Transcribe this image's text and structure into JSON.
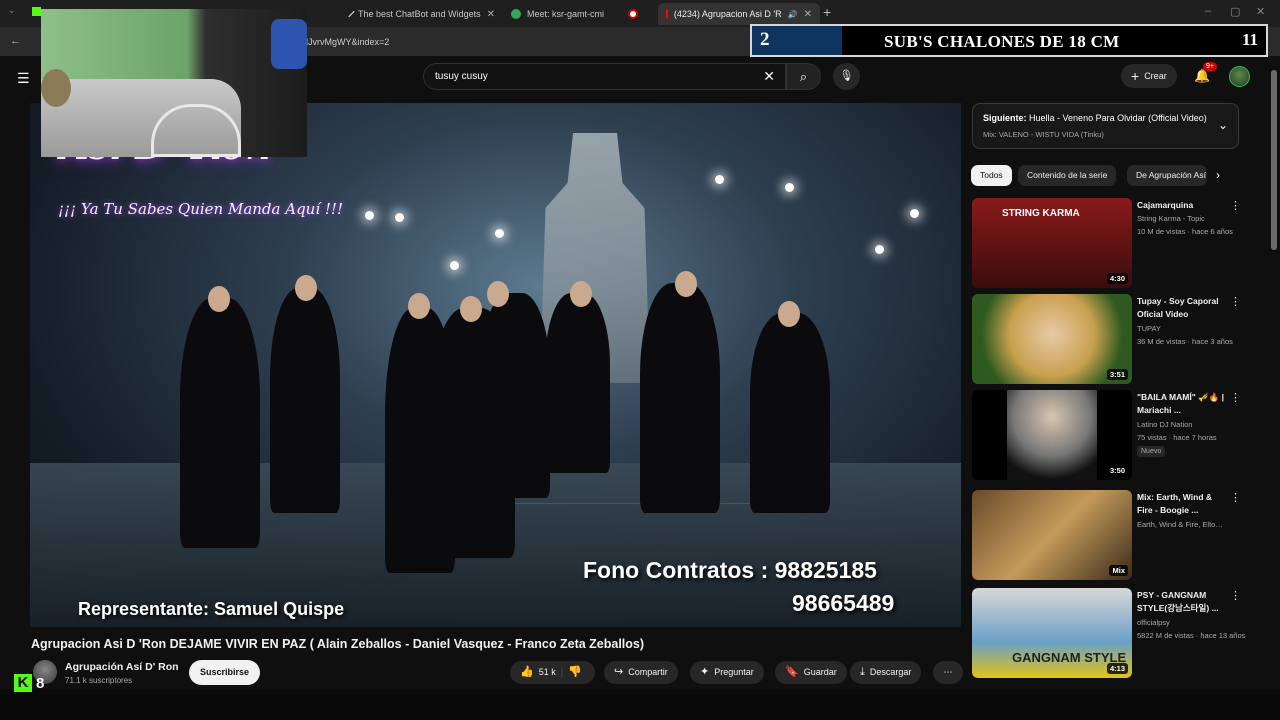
{
  "browser": {
    "tabs": [
      {
        "label": "ts"
      },
      {
        "label": "The best ChatBot and Widgets"
      },
      {
        "label": "Meet: ksr-gamt-cmi"
      },
      {
        "label": ""
      },
      {
        "label": "(4234) Agrupacion Asi D 'R"
      }
    ],
    "url": "lJvrvMgWY&index=2"
  },
  "overlay": {
    "sub_count": "2",
    "sub_goal": "SUB'S CHALONES DE 18 CM",
    "sub_target": "11",
    "kick_count": "8"
  },
  "masthead": {
    "search_value": "tusuy cusuy",
    "create_label": "Crear",
    "notif_badge": "9+"
  },
  "video": {
    "overlay_logo": "Asi D' Ron",
    "overlay_tagline": "¡¡¡ Ya Tu Sabes Quien Manda Aquí !!!",
    "overlay_contract": "Fono Contratos :   98825185",
    "overlay_contract2": "98665489",
    "overlay_rep": "Representante: Samuel Quispe",
    "title": "Agrupacion Asi D 'Ron DEJAME VIVIR EN PAZ ( Alain Zeballos - Daniel Vasquez - Franco Zeta Zeballos)",
    "channel": "Agrupación Así D' Ron",
    "subscribers": "71.1 k suscriptores",
    "subscribe_label": "Suscribirse",
    "likes": "51 k",
    "share_label": "Compartir",
    "ask_label": "Preguntar",
    "save_label": "Guardar",
    "download_label": "Descargar"
  },
  "sidebar": {
    "upnext_prefix": "Siguiente:",
    "upnext_title": "Huella - Veneno Para Olvidar (Official Video)",
    "upnext_sub": "Mix: VALENO - WISTU VIDA (Tinku)",
    "chips": [
      "Todos",
      "Contenido de la serie",
      "De Agrupación Así"
    ],
    "recs": [
      {
        "title": "Cajamarquina",
        "channel": "String Karma - Topic",
        "views": "10 M de vistas · hace 6 años",
        "duration": "4:30",
        "thumb_text": "STRING KARMA",
        "nuevo": ""
      },
      {
        "title": "Tupay - Soy Caporal Oficial Video",
        "channel": "TUPAY",
        "views": "36 M de vistas · hace 3 años",
        "duration": "3:51",
        "thumb_text": "",
        "nuevo": ""
      },
      {
        "title": "\"BAILA MAMÍ\" 🎺🔥 | Mariachi ...",
        "channel": "Latino DJ Nation",
        "views": "75 vistas · hace 7 horas",
        "duration": "3:50",
        "thumb_text": "",
        "nuevo": "Nuevo"
      },
      {
        "title": "Mix: Earth, Wind & Fire - Boogie ...",
        "channel": "Earth, Wind & Fire, Elton John...",
        "views": "",
        "duration": "Mix",
        "thumb_text": "",
        "nuevo": ""
      },
      {
        "title": "PSY - GANGNAM STYLE(강남스타일) ...",
        "channel": "officialpsy",
        "views": "5822 M de vistas · hace 13 años",
        "duration": "4:13",
        "thumb_text": "GANGNAM STYLE",
        "nuevo": ""
      }
    ]
  },
  "colors": {
    "accent": "#ff0000",
    "kick": "#53fc18",
    "bg": "#0f0f0f"
  }
}
